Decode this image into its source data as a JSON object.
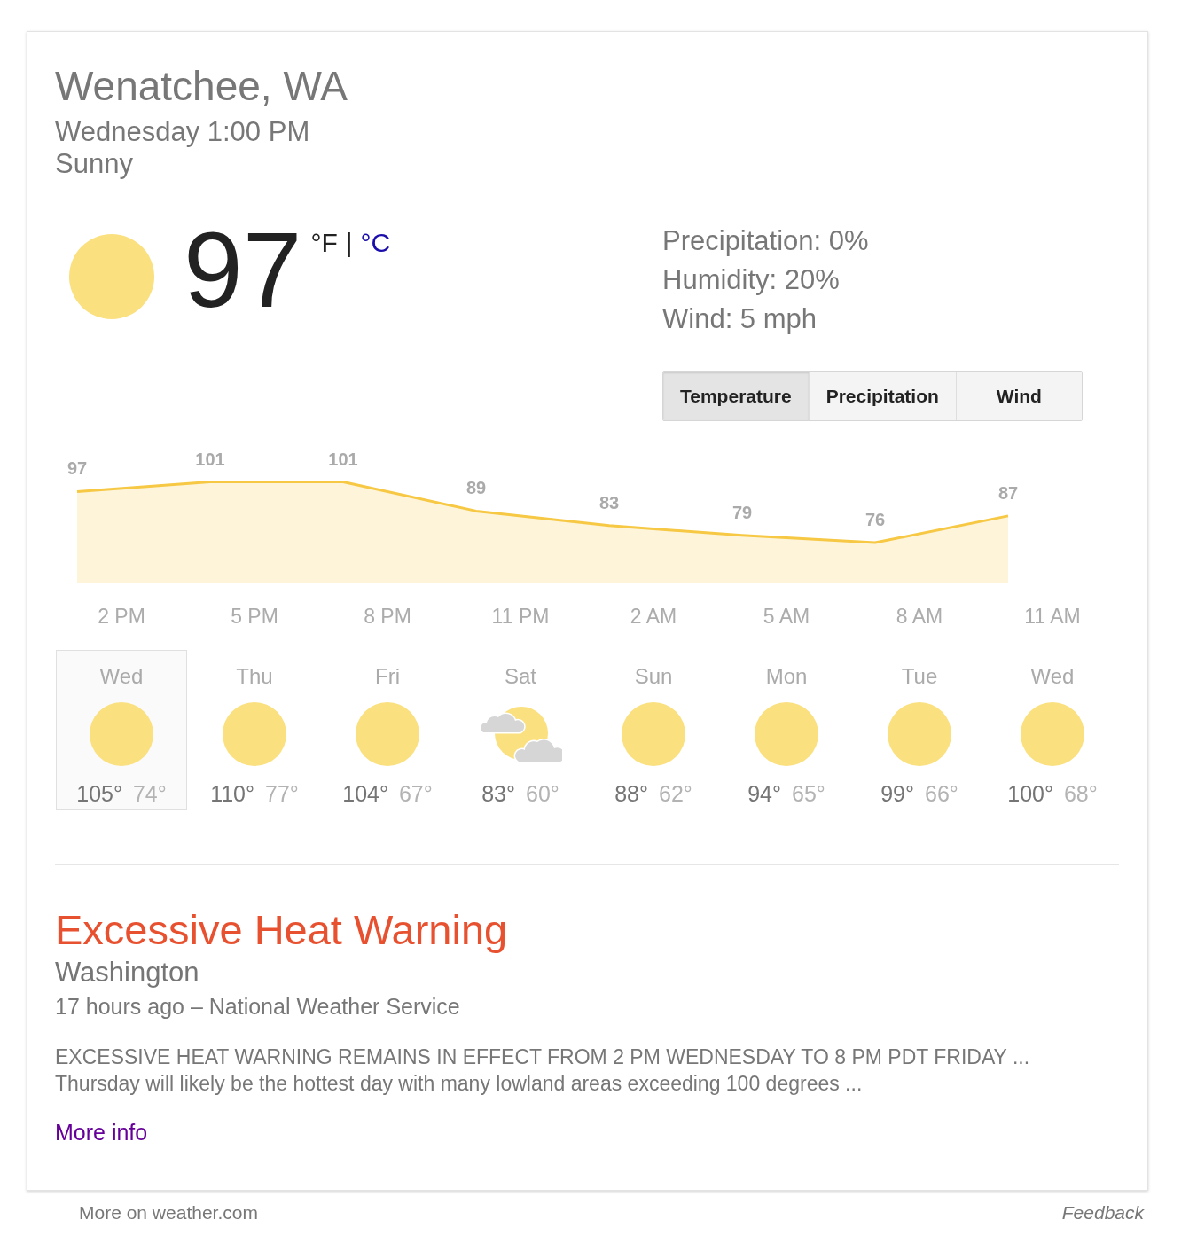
{
  "location": {
    "title": "Wenatchee, WA",
    "datetime": "Wednesday 1:00 PM",
    "condition": "Sunny"
  },
  "current": {
    "temperature": "97",
    "units": [
      {
        "label": "°F",
        "selected": true
      },
      {
        "label": "°C",
        "selected": false
      }
    ],
    "unit_separator": "|"
  },
  "details": [
    "Precipitation: 0%",
    "Humidity: 20%",
    "Wind: 5 mph"
  ],
  "tabs": [
    {
      "label": "Temperature",
      "selected": true
    },
    {
      "label": "Precipitation",
      "selected": false
    },
    {
      "label": "Wind",
      "selected": false
    }
  ],
  "hourly": {
    "chart_data": {
      "type": "area",
      "categories": [
        null,
        "2 PM",
        null,
        null,
        "5 PM",
        null,
        null,
        "8 PM",
        null,
        null,
        "11 PM",
        null,
        null,
        "2 AM",
        null,
        null,
        "5 AM",
        null,
        null,
        "8 AM",
        null,
        null,
        "11 AM",
        null
      ],
      "series": [
        {
          "color": "#f6c844",
          "values": [
            97,
            null,
            null,
            101,
            null,
            null,
            101,
            null,
            null,
            89,
            null,
            null,
            83,
            null,
            null,
            79,
            null,
            null,
            76,
            null,
            null,
            87,
            null,
            null
          ]
        }
      ],
      "data_labels": true
    }
  },
  "days": [
    {
      "name": "Wed",
      "kind": "sunny",
      "high": "105°",
      "low": "74°",
      "selected": true
    },
    {
      "name": "Thu",
      "kind": "sunny",
      "high": "110°",
      "low": "77°",
      "selected": false
    },
    {
      "name": "Fri",
      "kind": "sunny",
      "high": "104°",
      "low": "67°",
      "selected": false
    },
    {
      "name": "Sat",
      "kind": "partly_cloudy",
      "high": "83°",
      "low": "60°",
      "selected": false
    },
    {
      "name": "Sun",
      "kind": "sunny",
      "high": "88°",
      "low": "62°",
      "selected": false
    },
    {
      "name": "Mon",
      "kind": "sunny",
      "high": "94°",
      "low": "65°",
      "selected": false
    },
    {
      "name": "Tue",
      "kind": "sunny",
      "high": "99°",
      "low": "66°",
      "selected": false
    },
    {
      "name": "Wed",
      "kind": "sunny",
      "high": "100°",
      "low": "68°",
      "selected": false
    }
  ],
  "alert": {
    "title": "Excessive Heat Warning",
    "region": "Washington",
    "meta": "17 hours ago – National Weather Service",
    "body_lines": [
      "EXCESSIVE HEAT WARNING REMAINS IN EFFECT FROM 2 PM WEDNESDAY TO 8 PM PDT FRIDAY ...",
      "Thursday will likely be the hottest day with many lowland areas exceeding 100 degrees ..."
    ],
    "link": "More info"
  },
  "footer": {
    "source_link": "More on weather.com",
    "feedback": "Feedback"
  }
}
